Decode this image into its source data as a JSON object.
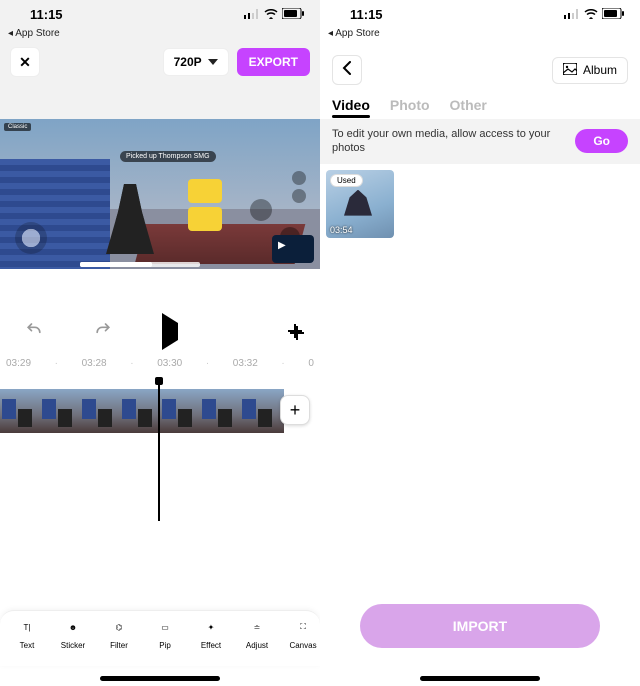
{
  "left": {
    "status_time": "11:15",
    "breadcrumb": "◂ App Store",
    "resolution_label": "720P",
    "export_label": "EXPORT",
    "game_banner": "Picked up Thompson SMG",
    "hud_label": "Classic",
    "ruler": [
      "03:29",
      "·",
      "03:28",
      "·",
      "03:30",
      "·",
      "03:32",
      "·",
      "0"
    ],
    "add_plus": "+",
    "tools": [
      {
        "id": "text",
        "label": "Text",
        "icon": "T|"
      },
      {
        "id": "sticker",
        "label": "Sticker",
        "icon": "☻"
      },
      {
        "id": "filter",
        "label": "Filter",
        "icon": "⌬"
      },
      {
        "id": "pip",
        "label": "Pip",
        "icon": "▭"
      },
      {
        "id": "effect",
        "label": "Effect",
        "icon": "✦"
      },
      {
        "id": "adjust",
        "label": "Adjust",
        "icon": "≐"
      },
      {
        "id": "canvas",
        "label": "Canvas",
        "icon": "⛶"
      }
    ]
  },
  "right": {
    "status_time": "11:15",
    "breadcrumb": "◂ App Store",
    "album_label": "Album",
    "tabs": [
      {
        "id": "video",
        "label": "Video",
        "active": true
      },
      {
        "id": "photo",
        "label": "Photo",
        "active": false
      },
      {
        "id": "other",
        "label": "Other",
        "active": false
      }
    ],
    "notice_text": "To edit your own media, allow access to your photos",
    "go_label": "Go",
    "media": [
      {
        "badge": "Used",
        "duration": "03:54"
      }
    ],
    "import_label": "IMPORT"
  }
}
